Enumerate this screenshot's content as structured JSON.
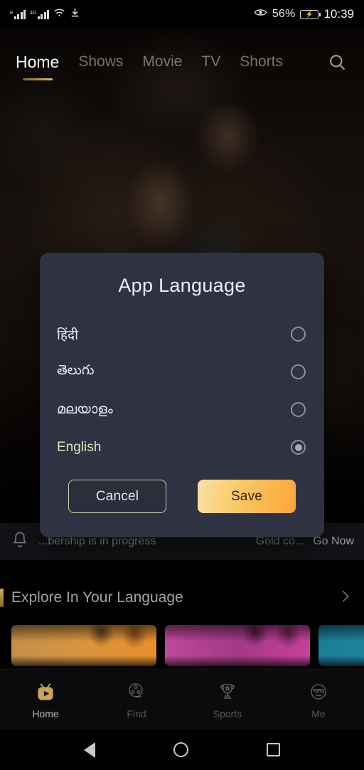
{
  "status_bar": {
    "network_label_1": "E",
    "network_label_2": "4G",
    "wifi_icon": "wifi-icon",
    "download_icon": "download-icon",
    "eye_icon": "eye-comfort-icon",
    "battery_percent": "56%",
    "battery_state": "charging",
    "time": "10:39"
  },
  "top_nav": {
    "items": [
      {
        "label": "Home",
        "active": true
      },
      {
        "label": "Shows",
        "active": false
      },
      {
        "label": "Movie",
        "active": false
      },
      {
        "label": "TV",
        "active": false
      },
      {
        "label": "Shorts",
        "active": false
      }
    ],
    "search_icon": "search-icon"
  },
  "notification": {
    "bell_icon": "bell-icon",
    "text": "...bership is in progress",
    "gold_text": "Gold co...",
    "cta": "Go Now"
  },
  "dialog": {
    "title": "App Language",
    "options": [
      {
        "label": "हिंदी",
        "selected": false
      },
      {
        "label": "తెలుగు",
        "selected": false
      },
      {
        "label": "മലയാളം",
        "selected": false
      },
      {
        "label": "English",
        "selected": true
      }
    ],
    "cancel_label": "Cancel",
    "save_label": "Save",
    "colors": {
      "surface": "#2e3242",
      "selected_text": "#e7e0ba",
      "save_gradient_start": "#f9e0a4",
      "save_gradient_end": "#fba53a",
      "cancel_border": "#d8cfa8"
    }
  },
  "section": {
    "title": "Explore In Your Language",
    "chevron_icon": "chevron-right-icon",
    "accent_color": "#d8ab55"
  },
  "rail": {
    "cards": [
      {
        "id": "card-1",
        "color": "#d79440"
      },
      {
        "id": "card-2",
        "color": "#c0499a"
      },
      {
        "id": "card-3",
        "color": "#2594ad"
      }
    ]
  },
  "tab_bar": {
    "items": [
      {
        "label": "Home",
        "icon": "tv-play-icon",
        "active": true
      },
      {
        "label": "Find",
        "icon": "film-reel-icon",
        "active": false
      },
      {
        "label": "Sports",
        "icon": "trophy-icon",
        "active": false
      },
      {
        "label": "Me",
        "icon": "face-sunglasses-icon",
        "active": false
      }
    ]
  },
  "system_nav": {
    "back_icon": "back-triangle-icon",
    "home_icon": "home-circle-icon",
    "recents_icon": "recents-square-icon"
  }
}
